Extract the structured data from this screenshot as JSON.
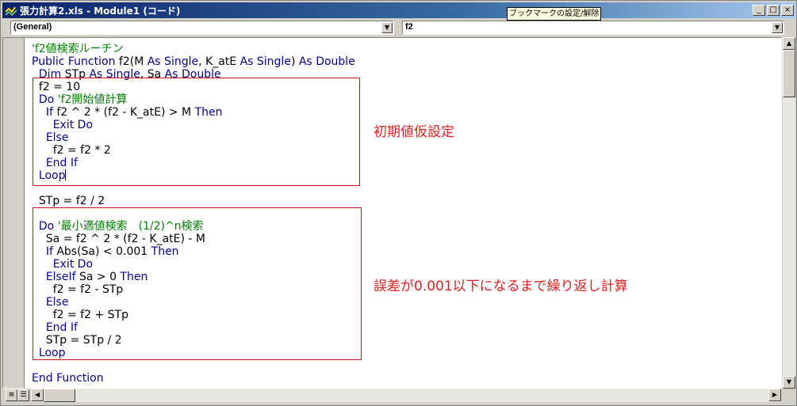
{
  "window": {
    "title": "張力計算2.xls - Module1 (コード)",
    "tooltip": "ブックマークの設定/解除",
    "buttons": {
      "minimize": "_",
      "maximize": "□",
      "close": "×"
    }
  },
  "toolbar": {
    "object_combo": "(General)",
    "proc_combo": "f2"
  },
  "code_lines": [
    {
      "type": "comment",
      "text": "'f2値検索ルーチン"
    },
    {
      "type": "code",
      "text": "Public Function f2(M As Single, K_atE As Single) As Double"
    },
    {
      "type": "code",
      "text": "  Dim STp As Single, Sa As Double"
    },
    {
      "type": "code",
      "text": "  f2 = 10"
    },
    {
      "type": "code",
      "text": "  Do 'f2開始値計算"
    },
    {
      "type": "code",
      "text": "    If f2 ^ 2 * (f2 - K_atE) > M Then"
    },
    {
      "type": "code",
      "text": "      Exit Do"
    },
    {
      "type": "code",
      "text": "    Else"
    },
    {
      "type": "code",
      "text": "      f2 = f2 * 2"
    },
    {
      "type": "code",
      "text": "    End If"
    },
    {
      "type": "code",
      "text": "  Loop"
    },
    {
      "type": "code",
      "text": ""
    },
    {
      "type": "code",
      "text": "  STp = f2 / 2"
    },
    {
      "type": "code",
      "text": ""
    },
    {
      "type": "code",
      "text": "  Do '最小適値検索　(1/2)^n検索"
    },
    {
      "type": "code",
      "text": "    Sa = f2 ^ 2 * (f2 - K_atE) - M"
    },
    {
      "type": "code",
      "text": "    If Abs(Sa) < 0.001 Then"
    },
    {
      "type": "code",
      "text": "      Exit Do"
    },
    {
      "type": "code",
      "text": "    ElseIf Sa > 0 Then"
    },
    {
      "type": "code",
      "text": "      f2 = f2 - STp"
    },
    {
      "type": "code",
      "text": "    Else"
    },
    {
      "type": "code",
      "text": "      f2 = f2 + STp"
    },
    {
      "type": "code",
      "text": "    End If"
    },
    {
      "type": "code",
      "text": "    STp = STp / 2"
    },
    {
      "type": "code",
      "text": "  Loop"
    },
    {
      "type": "code",
      "text": ""
    },
    {
      "type": "code",
      "text": "End Function"
    }
  ],
  "annotations": {
    "box1_label": "初期値仮設定",
    "box2_label": "誤差が0.001以下になるまで繰り返し計算"
  },
  "colors": {
    "keyword": "#00008b",
    "comment": "#008000",
    "annotation": "#e02020"
  },
  "icons": {
    "app": "vba-code-icon",
    "scroll_up": "▲",
    "scroll_down": "▼",
    "scroll_left": "◀",
    "scroll_right": "▶",
    "combo_arrow": "▼",
    "proc_view": "≡",
    "module_view": "☰"
  }
}
